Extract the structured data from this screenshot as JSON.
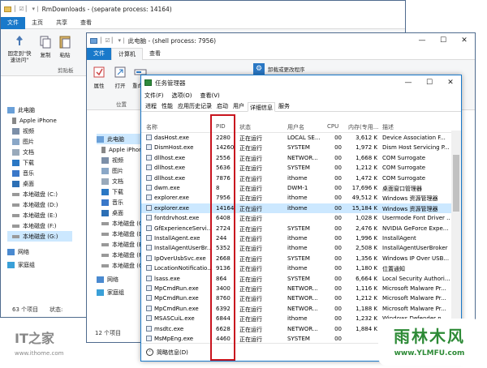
{
  "win1": {
    "title": "RmDownloads - (separate process: 14164)",
    "tabs": [
      "文件",
      "主页",
      "共享",
      "查看"
    ],
    "ribbon": [
      "固定到\"快速访问\"",
      "复制",
      "粘贴"
    ],
    "group_label": "剪贴板",
    "nav": [
      "此电脑",
      "Apple iPhone",
      "视频",
      "图片",
      "文档",
      "下载",
      "音乐",
      "桌面",
      "本地磁盘 (C:)",
      "本地磁盘 (D:)",
      "本地磁盘 (E:)",
      "本地磁盘 (F:)",
      "本地磁盘 (G:)",
      "网络",
      "家庭组"
    ],
    "status": "63 个项目",
    "status2": "状态:"
  },
  "win2": {
    "title": "此电脑 - (shell process: 7956)",
    "tabs": [
      "文件",
      "计算机",
      "查看"
    ],
    "ribbon": [
      "属性",
      "打开",
      "重命名"
    ],
    "group_label": "位置",
    "uninstall": "卸载或更改程序",
    "nav": [
      "此电脑",
      "Apple iPhone",
      "视频",
      "图片",
      "文档",
      "下载",
      "音乐",
      "桌面",
      "本地磁盘 (C:)",
      "本地磁盘 (D:)",
      "本地磁盘 (E:)",
      "本地磁盘 (F:)",
      "本地磁盘 (G:)",
      "网络",
      "家庭组"
    ],
    "status": "12 个项目"
  },
  "tm": {
    "title": "任务管理器",
    "menu": [
      "文件(F)",
      "选项(O)",
      "查看(V)"
    ],
    "tabs": [
      "进程",
      "性能",
      "应用历史记录",
      "启动",
      "用户",
      "详细信息",
      "服务"
    ],
    "active_tab": 5,
    "columns": [
      "名称",
      "PID",
      "状态",
      "用户名",
      "CPU",
      "内存(专用...",
      "描述"
    ],
    "rows": [
      [
        "dasHost.exe",
        "2280",
        "正在运行",
        "LOCAL SE...",
        "00",
        "3,612 K",
        "Device Association F..."
      ],
      [
        "DismHost.exe",
        "14260",
        "正在运行",
        "SYSTEM",
        "00",
        "1,972 K",
        "Dism Host Servicing P..."
      ],
      [
        "dllhost.exe",
        "2556",
        "正在运行",
        "NETWOR...",
        "00",
        "1,668 K",
        "COM Surrogate"
      ],
      [
        "dllhost.exe",
        "5636",
        "正在运行",
        "SYSTEM",
        "00",
        "1,212 K",
        "COM Surrogate"
      ],
      [
        "dllhost.exe",
        "7876",
        "正在运行",
        "ithome",
        "00",
        "1,472 K",
        "COM Surrogate"
      ],
      [
        "dwm.exe",
        "8",
        "正在运行",
        "DWM-1",
        "00",
        "17,696 K",
        "桌面窗口管理器"
      ],
      [
        "explorer.exe",
        "7956",
        "正在运行",
        "ithome",
        "00",
        "49,512 K",
        "Windows 资源管理器"
      ],
      [
        "explorer.exe",
        "14164",
        "正在运行",
        "ithome",
        "00",
        "15,184 K",
        "Windows 资源管理器"
      ],
      [
        "fontdrvhost.exe",
        "6408",
        "正在运行",
        "",
        "00",
        "1,028 K",
        "Usermode Font Driver ..."
      ],
      [
        "GfExperienceServi...",
        "2724",
        "正在运行",
        "SYSTEM",
        "00",
        "2,476 K",
        "NVIDIA GeForce Expe..."
      ],
      [
        "InstallAgent.exe",
        "244",
        "正在运行",
        "ithome",
        "00",
        "1,996 K",
        "InstallAgent"
      ],
      [
        "InstallAgentUserBr...",
        "5352",
        "正在运行",
        "ithome",
        "00",
        "2,508 K",
        "InstallAgentUserBroker"
      ],
      [
        "IpOverUsbSvc.exe",
        "2668",
        "正在运行",
        "SYSTEM",
        "00",
        "1,356 K",
        "Windows IP Over USB..."
      ],
      [
        "LocationNotificatio...",
        "9136",
        "正在运行",
        "ithome",
        "00",
        "1,180 K",
        "位置通知"
      ],
      [
        "lsass.exe",
        "864",
        "正在运行",
        "SYSTEM",
        "00",
        "6,664 K",
        "Local Security Authori..."
      ],
      [
        "MpCmdRun.exe",
        "3400",
        "正在运行",
        "NETWOR...",
        "00",
        "1,116 K",
        "Microsoft Malware Pr..."
      ],
      [
        "MpCmdRun.exe",
        "8760",
        "正在运行",
        "NETWOR...",
        "00",
        "1,212 K",
        "Microsoft Malware Pr..."
      ],
      [
        "MpCmdRun.exe",
        "6392",
        "正在运行",
        "NETWOR...",
        "00",
        "1,188 K",
        "Microsoft Malware Pr..."
      ],
      [
        "MSASCuiL.exe",
        "6844",
        "正在运行",
        "ithome",
        "00",
        "1,232 K",
        "Windows Defender n..."
      ],
      [
        "msdtc.exe",
        "6628",
        "正在运行",
        "NETWOR...",
        "00",
        "1,884 K",
        "Microsoft 分布式事务..."
      ],
      [
        "MsMpEng.exe",
        "4460",
        "正在运行",
        "SYSTEM",
        "00",
        "",
        ""
      ]
    ],
    "highlight_row": 7,
    "footer": "简略信息(D)"
  },
  "watermark_left": "IT之家",
  "watermark_url": "www.ithome.com",
  "watermark_right": "雨林木风",
  "watermark_right_url": "www.YLMFU.com",
  "colors": {
    "accent": "#1979ca",
    "highlight": "#cce8ff",
    "redbox": "#c8141e"
  }
}
